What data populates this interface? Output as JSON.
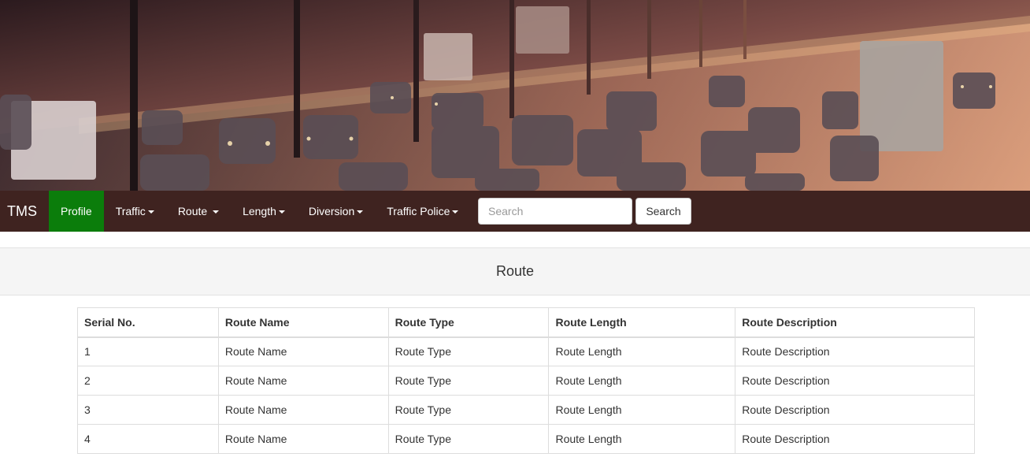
{
  "banner": {
    "image": "traffic-highway-sunset-photo"
  },
  "navbar": {
    "brand": "TMS",
    "items": [
      {
        "label": "Profile",
        "active": true,
        "dropdown": false
      },
      {
        "label": "Traffic",
        "active": false,
        "dropdown": true
      },
      {
        "label": "Route",
        "active": false,
        "dropdown": true
      },
      {
        "label": "Length",
        "active": false,
        "dropdown": true
      },
      {
        "label": "Diversion",
        "active": false,
        "dropdown": true
      },
      {
        "label": "Traffic Police",
        "active": false,
        "dropdown": true
      }
    ],
    "search": {
      "placeholder": "Search",
      "value": "",
      "button_label": "Search"
    },
    "colors": {
      "background": "#3f2320",
      "active": "#0b7d0b"
    }
  },
  "page": {
    "title": "Route"
  },
  "table": {
    "headers": [
      "Serial No.",
      "Route Name",
      "Route Type",
      "Route Length",
      "Route Description"
    ],
    "rows": [
      [
        "1",
        "Route Name",
        "Route Type",
        "Route Length",
        "Route Description"
      ],
      [
        "2",
        "Route Name",
        "Route Type",
        "Route Length",
        "Route Description"
      ],
      [
        "3",
        "Route Name",
        "Route Type",
        "Route Length",
        "Route Description"
      ],
      [
        "4",
        "Route Name",
        "Route Type",
        "Route Length",
        "Route Description"
      ]
    ]
  }
}
